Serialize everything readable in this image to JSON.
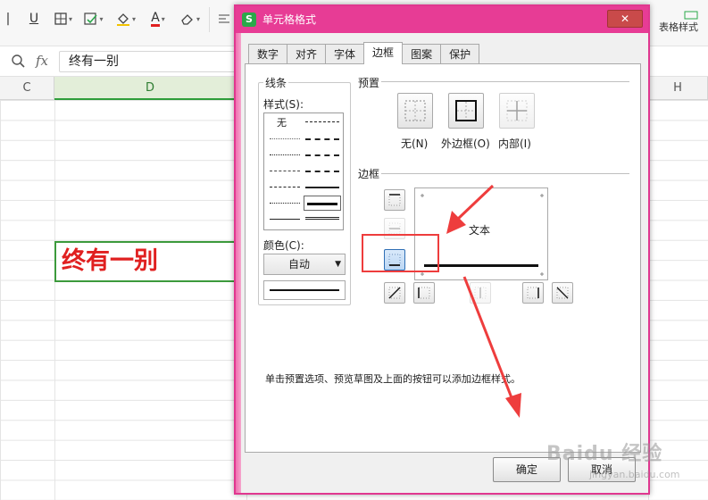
{
  "toolbar": {
    "underline_label": "U",
    "font_color_label": "A",
    "table_style_label": "表格样式"
  },
  "formula_bar": {
    "fx_label": "fx",
    "cell_value": "终有一别"
  },
  "columns": {
    "c": "C",
    "d": "D",
    "h": "H"
  },
  "sheet": {
    "active_cell_text": "终有一别"
  },
  "dialog": {
    "title": "单元格格式",
    "app_icon_letter": "S",
    "close_label": "✕",
    "tabs": [
      {
        "label": "数字"
      },
      {
        "label": "对齐"
      },
      {
        "label": "字体"
      },
      {
        "label": "边框"
      },
      {
        "label": "图案"
      },
      {
        "label": "保护"
      }
    ],
    "active_tab": "边框",
    "lines_group": {
      "title": "线条",
      "style_label": "样式(S):",
      "none_label": "无",
      "color_label": "颜色(C):",
      "color_value": "自动"
    },
    "presets": {
      "title": "预置",
      "items": [
        {
          "label": "无(N)"
        },
        {
          "label": "外边框(O)"
        },
        {
          "label": "内部(I)"
        }
      ]
    },
    "border": {
      "title": "边框",
      "preview_text": "文本"
    },
    "hint": "单击预置选项、预览草图及上面的按钮可以添加边框样式。",
    "ok_label": "确定",
    "cancel_label": "取消"
  },
  "watermark": {
    "main": "Baidu 经验",
    "sub": "jingyan.baidu.com"
  },
  "colors": {
    "dialog_border": "#e0378f",
    "title_bar": "#e73c95",
    "annotation_red": "#ee3d3d",
    "cell_text": "#e02020",
    "active_cell_border": "#3c9a3c"
  }
}
